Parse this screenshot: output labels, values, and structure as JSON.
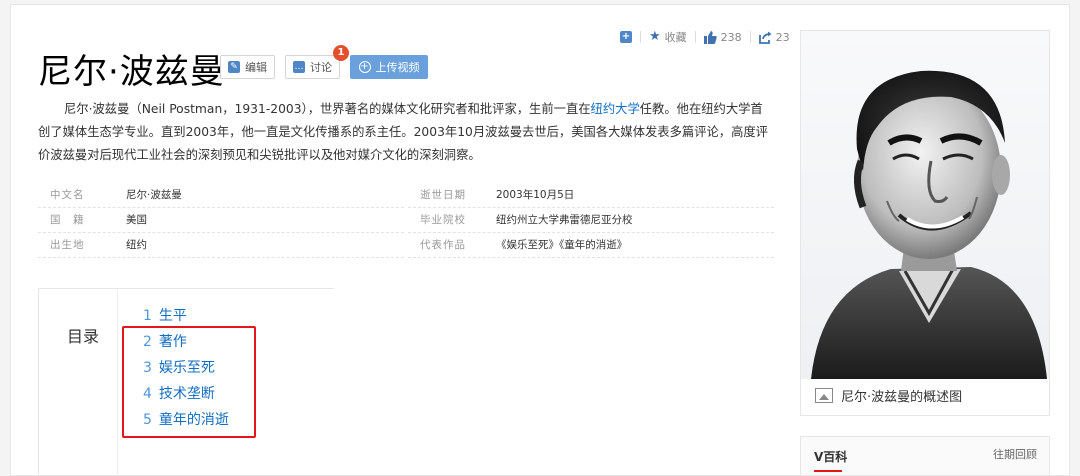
{
  "toolbar": {
    "collect_label": "收藏",
    "like_count": "238",
    "share_count": "23"
  },
  "header": {
    "title": "尼尔·波兹曼",
    "edit_label": "编辑",
    "discuss_label": "讨论",
    "discuss_badge": "1",
    "upload_label": "上传视频"
  },
  "summary": {
    "text_before_link": "尼尔·波兹曼（Neil Postman，1931-2003），世界著名的媒体文化研究者和批评家，生前一直在",
    "link_text": "纽约大学",
    "text_after_link": "任教。他在纽约大学首创了媒体生态学专业。直到2003年，他一直是文化传播系的系主任。2003年10月波兹曼去世后，美国各大媒体发表多篇评论，高度评价波兹曼对后现代工业社会的深刻预见和尖锐批评以及他对媒介文化的深刻洞察。"
  },
  "basic_info": [
    {
      "left_name": "中文名",
      "left_value": "尼尔·波兹曼",
      "right_name": "逝世日期",
      "right_value": "2003年10月5日"
    },
    {
      "left_name": "国　籍",
      "left_value": "美国",
      "right_name": "毕业院校",
      "right_value": "纽约州立大学弗雷德尼亚分校"
    },
    {
      "left_name": "出生地",
      "left_value": "纽约",
      "right_name": "代表作品",
      "right_value": "《娱乐至死》《童年的消逝》"
    }
  ],
  "catalog": {
    "title": "目录",
    "items": [
      {
        "num": "1",
        "label": "生平"
      },
      {
        "num": "2",
        "label": "著作"
      },
      {
        "num": "3",
        "label": "娱乐至死"
      },
      {
        "num": "4",
        "label": "技术垄断"
      },
      {
        "num": "5",
        "label": "童年的消逝"
      }
    ]
  },
  "portrait": {
    "caption": "尼尔·波兹曼的概述图"
  },
  "vcard": {
    "title": "V百科",
    "more_label": "往期回顾"
  },
  "colors": {
    "link": "#136ec2",
    "accent_blue": "#4f87c6",
    "highlight_red": "#e3161c",
    "badge_red": "#e4502e"
  }
}
